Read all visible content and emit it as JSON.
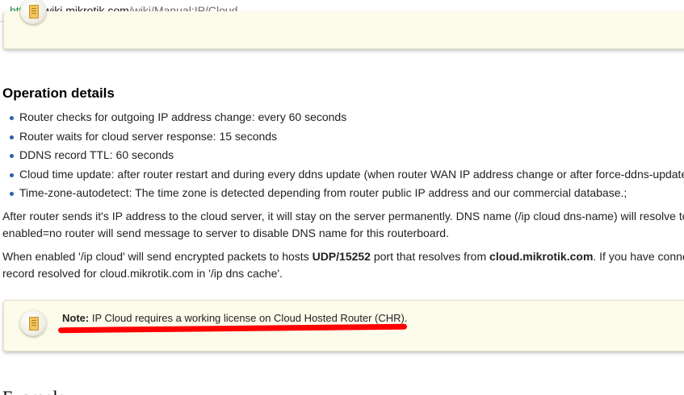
{
  "address_bar": {
    "protocol": "https://",
    "host": "wiki.mikrotik.com",
    "path": "/wiki/Manual:IP/Cloud"
  },
  "operation_details": {
    "heading": "Operation details",
    "items": [
      "Router checks for outgoing IP address change: every 60 seconds",
      "Router waits for cloud server response: 15 seconds",
      "DDNS record TTL: 60 seconds",
      "Cloud time update: after router restart and during every ddns update (when router WAN IP address change or after force-ddns-update",
      "Time-zone-autodetect: The time zone is detected depending from router public IP address and our commercial database.;"
    ]
  },
  "paragraph1": {
    "line1": "After router sends it's IP address to the cloud server, it will stay on the server permanently. DNS name (/ip cloud dns-name) will resolve to",
    "line2": "enabled=no router will send message to server to disable DNS name for this routerboard."
  },
  "paragraph2": {
    "line1_before": "When enabled '/ip cloud' will send encrypted packets to hosts ",
    "line1_bold1": "UDP/15252",
    "line1_middle": " port that resolves from ",
    "line1_bold2": "cloud.mikrotik.com",
    "line1_after": ". If you have conne",
    "line2": "record resolved for cloud.mikrotik.com in '/ip dns cache'."
  },
  "note": {
    "label": "Note:",
    "text": " IP Cloud requires a working license on Cloud Hosted Router (CHR)."
  },
  "next_heading": "Example",
  "colors": {
    "note_background": "#fdfbea",
    "annotation_underline": "#ff0000",
    "url_protocol": "#1b8a3a",
    "bullet": "#2a5db0"
  },
  "icons": [
    "note-icon"
  ]
}
